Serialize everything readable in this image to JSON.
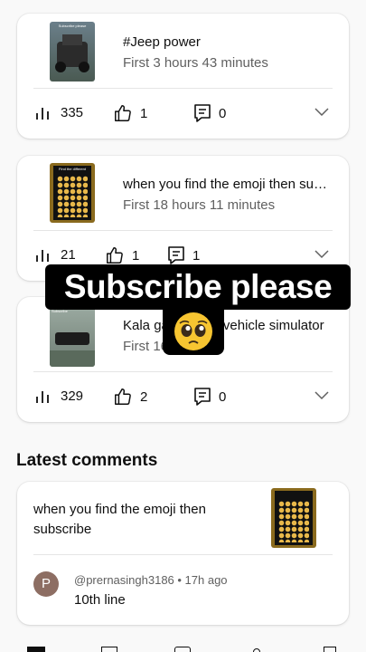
{
  "videos": [
    {
      "title": "#Jeep power",
      "subtitle": "First 3 hours 43 minutes",
      "views": "335",
      "likes": "1",
      "comments": "0",
      "thumb_text": "Subscribe please"
    },
    {
      "title": "when you find the emoji then subscribe",
      "subtitle": "First 18 hours 11 minutes",
      "views": "21",
      "likes": "1",
      "comments": "1",
      "thumb_text": "Find the different"
    },
    {
      "title": "Kala gadi indian vehicle simulator",
      "subtitle": "First 16 hours",
      "views": "329",
      "likes": "2",
      "comments": "0",
      "thumb_text": "Subscribe"
    }
  ],
  "latest_comments": {
    "section_title": "Latest comments",
    "video_title": "when you find the emoji then subscribe",
    "avatar_letter": "P",
    "author": "@prernasingh3186",
    "time": "17h ago",
    "author_line": "@prernasingh3186 • 17h ago",
    "text": "10th line"
  },
  "overlay": {
    "caption": "Subscribe please",
    "emoji": "🥺"
  },
  "colors": {
    "background": "#f9f9f9",
    "card": "#ffffff",
    "secondary_text": "#606060",
    "avatar": "#8d6e63",
    "overlay": "#000000"
  },
  "icons": {
    "views": "bar-chart-icon",
    "likes": "thumbs-up-icon",
    "comments": "comment-icon",
    "expand": "chevron-down-icon"
  }
}
